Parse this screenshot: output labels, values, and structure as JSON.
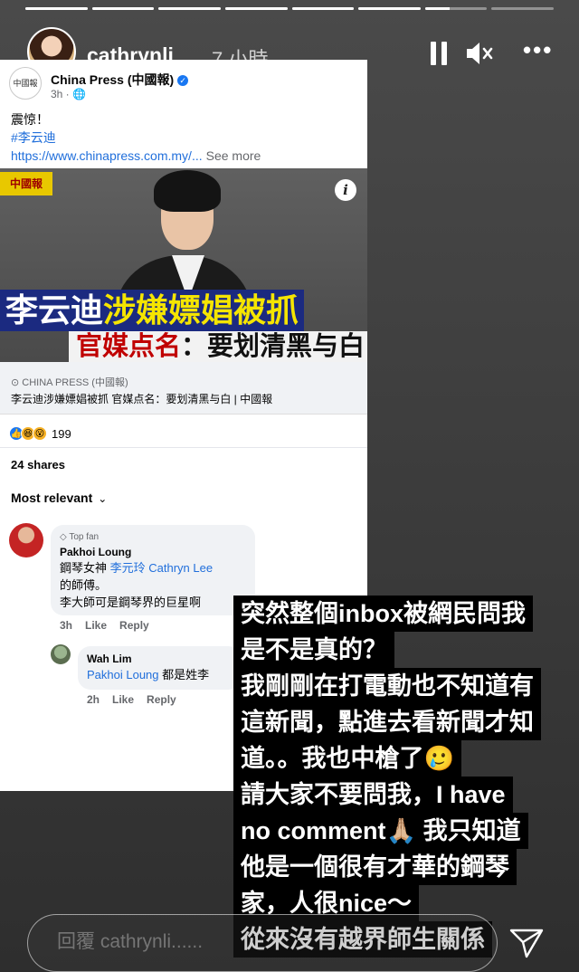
{
  "story": {
    "progress_segments": [
      1,
      1,
      1,
      1,
      1,
      1,
      0.4,
      0
    ],
    "username": "cathrynli",
    "time_ago": "7 小時",
    "controls": {
      "pause": "pause-icon",
      "mute": "speaker-muted-icon",
      "more": "•••"
    }
  },
  "post": {
    "page_name": "China Press (中國報)",
    "time": "3h ·",
    "logo_text": "中國報",
    "text_line1": "震惊！",
    "hashtag": "#李云迪",
    "link": "https://www.chinapress.com.my/...",
    "see_more": "See more",
    "image": {
      "logo": "中國報",
      "headline1_a": "李云迪",
      "headline1_b": "涉嫌嫖娼被抓",
      "headline2_a": "官媒点名",
      "headline2_b": "：要划清黑与白"
    },
    "link_source": "CHINA PRESS (中國報)",
    "link_title": "李云迪涉嫌嫖娼被抓 官媒点名：要划清黑与白 | 中國報",
    "reaction_count": "199",
    "shares": "24 shares",
    "sort_label": "Most relevant",
    "comments": [
      {
        "badge": "Top fan",
        "name": "Pakhoi Loung",
        "line1_a": "鋼琴女神",
        "line1_mention": "李元玲 Cathryn Lee",
        "line2": "的師傅。",
        "line3": "李大師可是鋼琴界的巨星啊",
        "time": "3h",
        "like": "Like",
        "reply": "Reply"
      },
      {
        "name": "Wah Lim",
        "mention": "Pakhoi Loung",
        "text": "都是姓李",
        "time": "2h",
        "like": "Like",
        "reply": "Reply"
      }
    ]
  },
  "caption_lines": [
    "突然整個inbox被網民問我",
    "是不是真的？",
    "我剛剛在打電動也不知道有",
    "這新聞，點進去看新聞才知",
    "道。。我也中槍了🥲",
    "請大家不要問我，I have",
    "no comment🙏🏼 我只知道",
    "他是一個很有才華的鋼琴",
    "家，人很nice～",
    "從來沒有越界師生關係"
  ],
  "reply": {
    "placeholder": "回覆 cathrynli......",
    "send_icon": "paper-plane-icon"
  }
}
